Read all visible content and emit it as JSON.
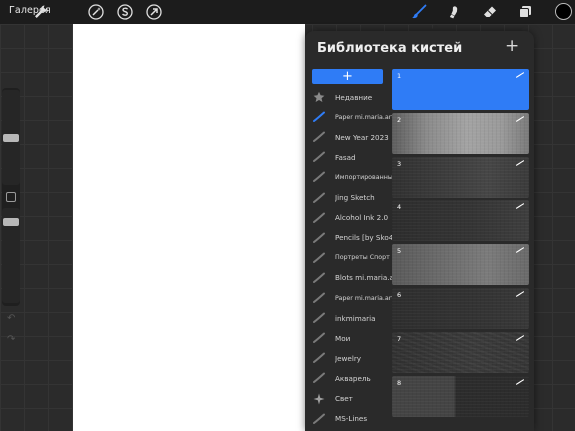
{
  "topbar": {
    "gallery_label": "Галерея",
    "tools": [
      {
        "name": "wrench-icon"
      },
      {
        "name": "magic-wand-icon"
      },
      {
        "name": "selection-s-icon"
      },
      {
        "name": "transform-arrow-icon"
      },
      {
        "name": "brush-icon",
        "active": true
      },
      {
        "name": "smudge-icon"
      },
      {
        "name": "eraser-icon"
      },
      {
        "name": "layers-icon"
      }
    ],
    "current_color": "#000000"
  },
  "colors": {
    "accent": "#2f7cf6",
    "panel_bg": "#2a2a2a",
    "canvas": "#ffffff"
  },
  "brush_library": {
    "title": "Библиотека кистей",
    "add_symbol": "+",
    "add_set_symbol": "+",
    "sets": [
      {
        "label": "Недавние",
        "icon": "star-icon",
        "size": "normal"
      },
      {
        "label": "Paper mi.maria.art",
        "icon": "brush-stroke-icon",
        "size": "small",
        "selected": true
      },
      {
        "label": "New Year 2023",
        "icon": "brush-stroke-icon",
        "size": "normal"
      },
      {
        "label": "Fasad",
        "icon": "brush-stroke-icon",
        "size": "normal"
      },
      {
        "label": "Импортированные",
        "icon": "brush-stroke-icon",
        "size": "small"
      },
      {
        "label": "Jing Sketch",
        "icon": "brush-stroke-icon",
        "size": "normal"
      },
      {
        "label": "Alcohol Ink 2.0",
        "icon": "brush-stroke-icon",
        "size": "normal"
      },
      {
        "label": "Pencils [by Sko4]",
        "icon": "brush-stroke-icon",
        "size": "normal"
      },
      {
        "label": "Портреты Спорт",
        "icon": "brush-stroke-icon",
        "size": "small"
      },
      {
        "label": "Blots mi.maria.art",
        "icon": "brush-stroke-icon",
        "size": "normal"
      },
      {
        "label": "Paper mi.maria.art",
        "icon": "brush-stroke-icon",
        "size": "small"
      },
      {
        "label": "inkmimaria",
        "icon": "brush-stroke-icon",
        "size": "normal"
      },
      {
        "label": "Мои",
        "icon": "brush-stroke-icon",
        "size": "normal"
      },
      {
        "label": "Jewelry",
        "icon": "brush-stroke-icon",
        "size": "normal"
      },
      {
        "label": "Акварель",
        "icon": "brush-stroke-icon",
        "size": "normal"
      },
      {
        "label": "Свет",
        "icon": "sparkle-icon",
        "size": "normal"
      },
      {
        "label": "MS-Lines",
        "icon": "brush-stroke-icon",
        "size": "normal"
      }
    ],
    "brushes": [
      {
        "number": "1",
        "selected": true
      },
      {
        "number": "2"
      },
      {
        "number": "3"
      },
      {
        "number": "4"
      },
      {
        "number": "5"
      },
      {
        "number": "6"
      },
      {
        "number": "7"
      },
      {
        "number": "8"
      }
    ]
  },
  "sidebar": {
    "undo_symbol": "↶",
    "redo_symbol": "↷"
  }
}
